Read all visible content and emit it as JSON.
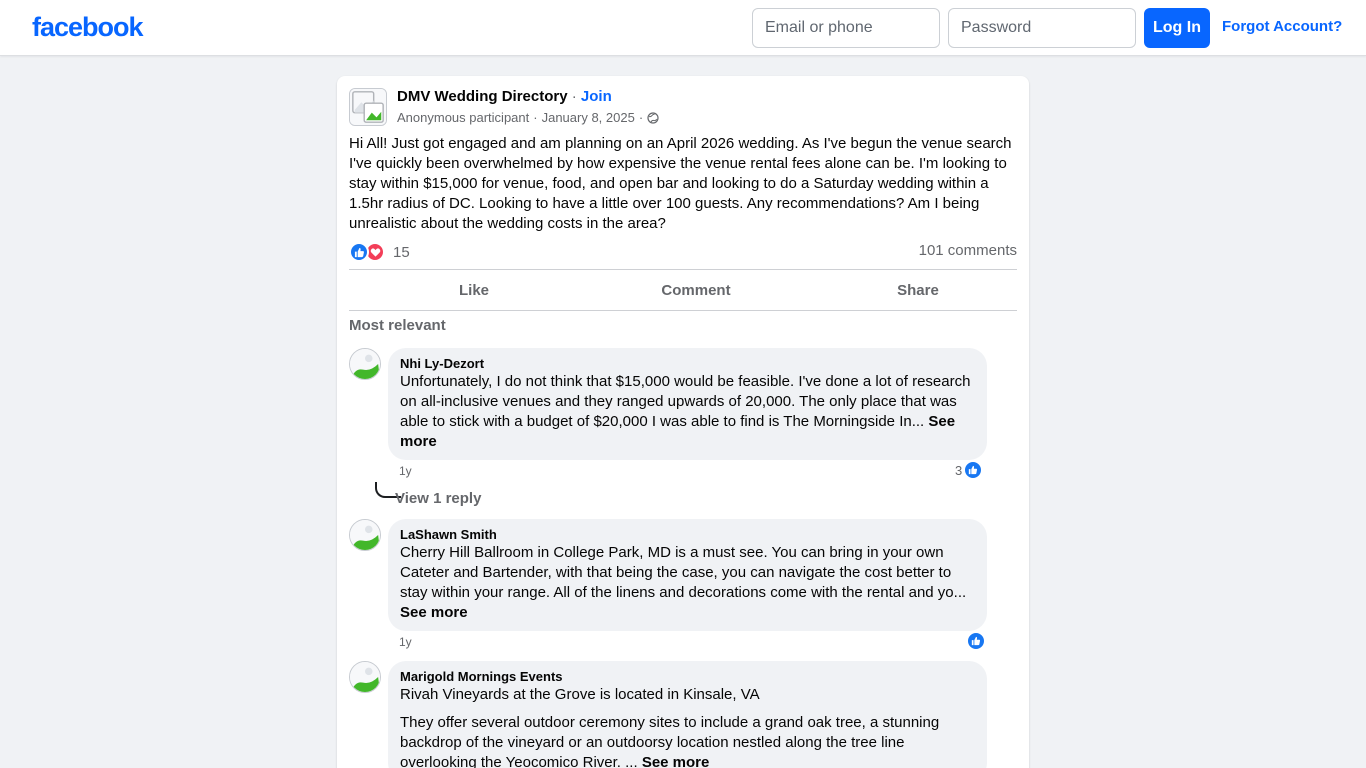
{
  "header": {
    "logo": "facebook",
    "email_placeholder": "Email or phone",
    "password_placeholder": "Password",
    "login_label": "Log In",
    "forgot_label": "Forgot Account?",
    "brand_color": "#0866ff"
  },
  "post": {
    "group_name": "DMV Wedding Directory",
    "join_separator": " · ",
    "join_label": "Join",
    "author": "Anonymous participant",
    "date": "January 8, 2025",
    "meta_separator": "·",
    "audience_icon": "globe-icon",
    "text": "Hi All! Just got engaged and am planning on an April 2026 wedding. As I've begun the venue search I've quickly been overwhelmed by how expensive the venue rental fees alone can be. I'm looking to stay within $15,000 for venue, food, and open bar and looking to do a Saturday wedding within a 1.5hr radius of DC. Looking to have a little over 100 guests. Any recommendations? Am I being unrealistic about the wedding costs in the area?",
    "reaction_count": "15",
    "reaction_icons": [
      "like-icon",
      "love-icon"
    ],
    "comments_count": "101 comments",
    "actions": {
      "like": "Like",
      "comment": "Comment",
      "share": "Share"
    },
    "sort_label": "Most relevant"
  },
  "comments": [
    {
      "author": "Nhi Ly-Dezort",
      "text": "Unfortunately, I do not think that $15,000 would be feasible. I've done a lot of research on all-inclusive venues and they ranged upwards of 20,000. The only place that was able to stick with a budget of $20,000 I was able to find is The Morningside In...",
      "see_more": "See more",
      "time": "1y",
      "likes": "3",
      "view_replies": "View 1 reply"
    },
    {
      "author": "LaShawn Smith",
      "text": "Cherry Hill Ballroom in College Park, MD is a must see. You can bring in your own Cateter and Bartender, with that being the case, you can navigate the cost better to stay within your range. All of the linens and decorations come with the rental and yo...",
      "see_more": "See more",
      "time": "1y",
      "likes": ""
    },
    {
      "author": "Marigold Mornings Events",
      "text_line1": "Rivah Vineyards at the Grove is located in Kinsale, VA",
      "text_line2": "They offer several outdoor ceremony sites to include a grand oak tree, a stunning backdrop of the vineyard or an outdoorsy location nestled along the tree line overlooking the Yeocomico River. ...",
      "see_more": "See more"
    }
  ],
  "colors": {
    "like_blue": "#1877f2",
    "love_red": "#f33e58",
    "secondary_text": "#65676b",
    "bubble_bg": "#f0f2f5"
  }
}
